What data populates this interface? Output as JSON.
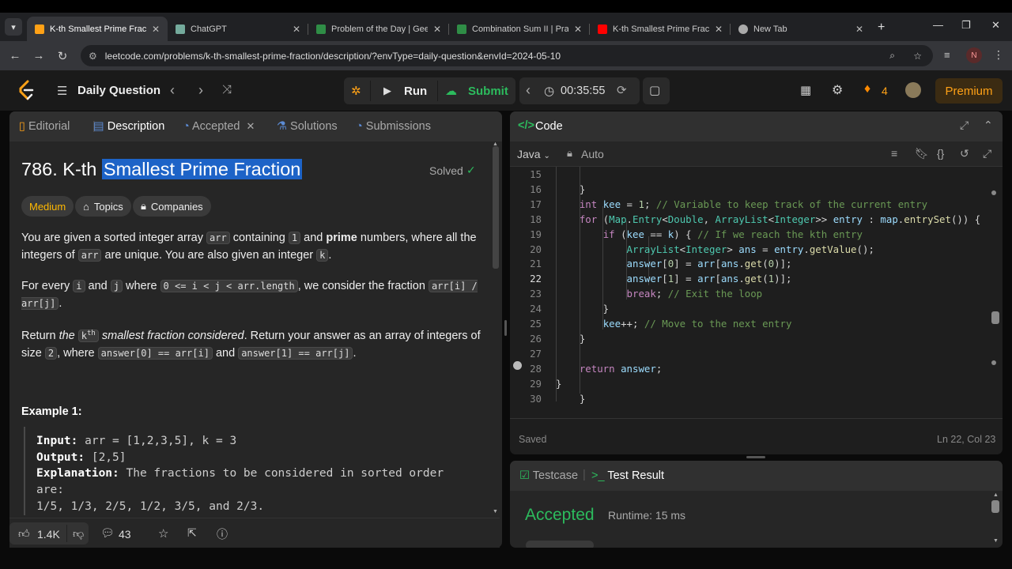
{
  "browser": {
    "tabs": [
      {
        "title": "K-th Smallest Prime Fractio",
        "favicon_color": "#ffa116",
        "active": true
      },
      {
        "title": "ChatGPT",
        "favicon_color": "#74aa9c",
        "active": false
      },
      {
        "title": "Problem of the Day | Geeks",
        "favicon_color": "#2f8d46",
        "active": false
      },
      {
        "title": "Combination Sum II | Pract",
        "favicon_color": "#2f8d46",
        "active": false
      },
      {
        "title": "K-th Smallest Prime Fractio",
        "favicon_color": "#ff0000",
        "active": false
      },
      {
        "title": "New Tab",
        "favicon_color": "#aaaaaa",
        "active": false
      }
    ],
    "url": "leetcode.com/problems/k-th-smallest-prime-fraction/description/?envType=daily-question&envId=2024-05-10",
    "profile_initial": "N"
  },
  "nav": {
    "title": "Daily Question",
    "run": "Run",
    "submit": "Submit",
    "timer": "00:35:55",
    "streak": "4",
    "premium": "Premium"
  },
  "left_tabs": {
    "editorial": "Editorial",
    "description": "Description",
    "accepted": "Accepted",
    "solutions": "Solutions",
    "submissions": "Submissions"
  },
  "problem": {
    "number_prefix": "786. K-th ",
    "title_highlight": "Smallest Prime Fraction",
    "status": "Solved",
    "difficulty": "Medium",
    "topics": "Topics",
    "companies": "Companies",
    "p1": {
      "a": "You are given a sorted integer array ",
      "c1": "arr",
      "b": " containing ",
      "c2": "1",
      "c": " and ",
      "bold": "prime",
      "d": " numbers, where all the integers of ",
      "c3": "arr",
      "e": " are unique. You are also given an integer ",
      "c4": "k",
      "f": "."
    },
    "p2": {
      "a": "For every ",
      "c1": "i",
      "b": " and ",
      "c2": "j",
      "c": " where ",
      "c3": "0 <= i < j < arr.length",
      "d": ", we consider the fraction ",
      "c4": "arr[i] / arr[j]",
      "e": "."
    },
    "p3": {
      "a": "Return ",
      "i1": "the",
      "c1": "k",
      "sup": "th",
      "i2": "smallest fraction considered",
      "b": ". Return your answer as an array of integers of size ",
      "c2": "2",
      "c": ", where ",
      "c3": "answer[0] == arr[i]",
      "d": " and ",
      "c4": "answer[1] == arr[j]",
      "e": "."
    },
    "example_title": "Example 1:",
    "example": {
      "input_label": "Input:",
      "input": " arr = [1,2,3,5], k = 3",
      "output_label": "Output:",
      "output": " [2,5]",
      "expl_label": "Explanation:",
      "expl1": " The fractions to be considered in sorted order",
      "expl2": "are:",
      "expl3": "1/5, 1/3, 2/5, 1/2, 3/5, and 2/3."
    }
  },
  "bottom": {
    "likes": "1.4K",
    "comments": "43"
  },
  "code_panel": {
    "title": "Code",
    "language": "Java",
    "mode": "Auto",
    "saved": "Saved",
    "cursor": "Ln 22, Col 23"
  },
  "code_lines": [
    {
      "n": "15",
      "t": "            "
    },
    {
      "n": "16",
      "t": "            }"
    },
    {
      "n": "17",
      "t": "            int kee = 1; // Variable to keep track of the current entry"
    },
    {
      "n": "18",
      "t": "            for (Map.Entry<Double, ArrayList<Integer>> entry : map.entrySet()) {"
    },
    {
      "n": "19",
      "t": "                if (kee == k) { // If we reach the kth entry"
    },
    {
      "n": "20",
      "t": "                    ArrayList<Integer> ans = entry.getValue();"
    },
    {
      "n": "21",
      "t": "                    answer[0] = arr[ans.get(0)];"
    },
    {
      "n": "22",
      "t": "                    answer[1] = arr[ans.get(1)];"
    },
    {
      "n": "23",
      "t": "                    break; // Exit the loop"
    },
    {
      "n": "24",
      "t": "                }"
    },
    {
      "n": "25",
      "t": "                kee++; // Move to the next entry"
    },
    {
      "n": "26",
      "t": "            }"
    },
    {
      "n": "27",
      "t": ""
    },
    {
      "n": "28",
      "t": "            return answer;"
    },
    {
      "n": "29",
      "t": "        }"
    },
    {
      "n": "30",
      "t": "    }"
    }
  ],
  "result_panel": {
    "testcase": "Testcase",
    "test_result": "Test Result",
    "status": "Accepted",
    "runtime": "Runtime: 15 ms"
  }
}
